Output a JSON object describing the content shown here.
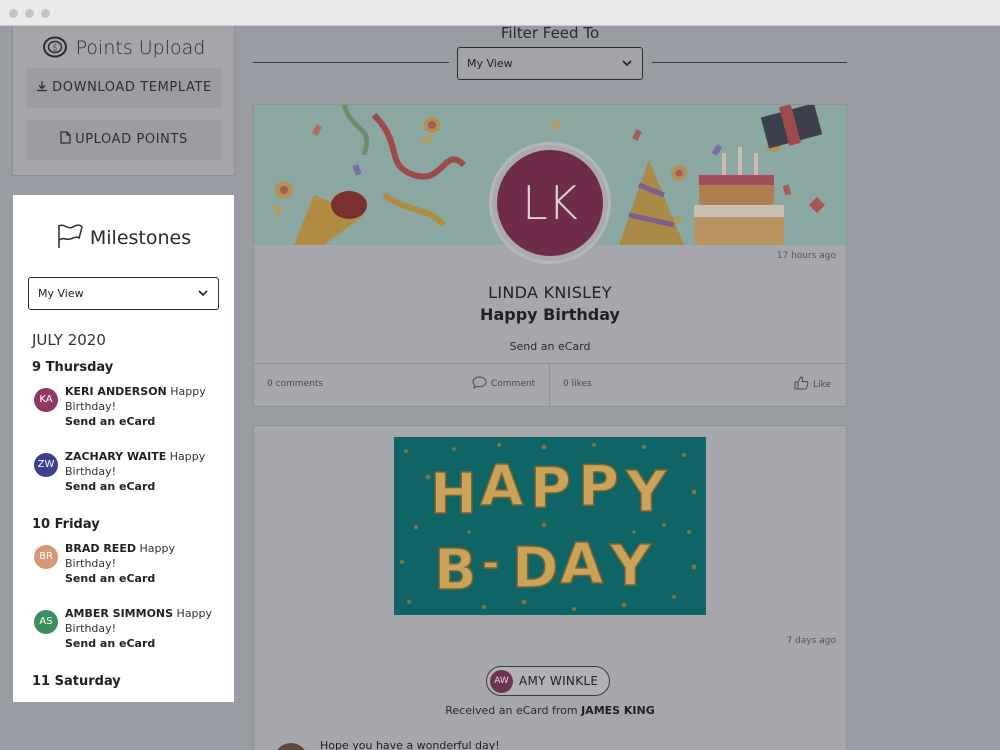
{
  "points": {
    "title": "Points Upload",
    "download_label": "DOWNLOAD TEMPLATE",
    "upload_label": "UPLOAD POINTS"
  },
  "milestones": {
    "title": "Milestones",
    "view_select": "My View",
    "month": "JULY 2020",
    "days": [
      {
        "label": "9 Thursday",
        "entries": [
          {
            "initials": "KA",
            "name": "KERI ANDERSON",
            "event": "Happy Birthday!",
            "action": "Send an eCard",
            "color": "#8e3a62"
          },
          {
            "initials": "ZW",
            "name": "ZACHARY WAITE",
            "event": "Happy Birthday!",
            "action": "Send an eCard",
            "color": "#3f3f8f"
          }
        ]
      },
      {
        "label": "10 Friday",
        "entries": [
          {
            "initials": "BR",
            "name": "BRAD REED",
            "event": "Happy Birthday!",
            "action": "Send an eCard",
            "color": "#d59873"
          },
          {
            "initials": "AS",
            "name": "AMBER SIMMONS",
            "event": "Happy Birthday!",
            "action": "Send an eCard",
            "color": "#3b8f5d"
          }
        ]
      },
      {
        "label": "11 Saturday",
        "entries": []
      }
    ]
  },
  "feed": {
    "filter_label": "Filter Feed To",
    "filter_value": "My View",
    "card1": {
      "initials": "LK",
      "timestamp": "17 hours ago",
      "name": "LINDA KNISLEY",
      "event": "Happy Birthday",
      "ecard_link": "Send an eCard",
      "comments": "0 comments",
      "comment_label": "Comment",
      "likes": "0 likes",
      "like_label": "Like"
    },
    "card2": {
      "timestamp": "7 days ago",
      "recipient_initials": "AW",
      "recipient_name": "AMY WINKLE",
      "received_prefix": "Received an eCard from",
      "sender": "JAMES KING",
      "message": "Hope you have a wonderful day!"
    }
  },
  "colors": {
    "overlay": "#9a9ca3",
    "milestone_panel": "#ffffff",
    "lk_avatar": "#6e2c4a",
    "aw_avatar": "#6c3451",
    "bday_teal": "#0f6466",
    "balloon_gold": "#c9a35a"
  }
}
